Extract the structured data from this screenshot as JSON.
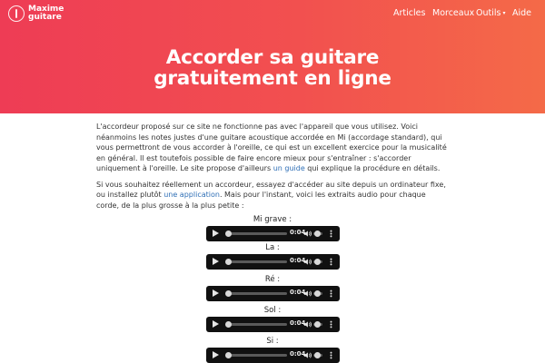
{
  "brand": {
    "line1": "Maxime",
    "line2": "guitare"
  },
  "nav": {
    "articles": "Articles",
    "morceaux": "Morceaux",
    "outils": "Outils",
    "outils_caret": "▾",
    "aide": "Aide"
  },
  "hero": {
    "title": "Accorder sa guitare gratuitement en ligne"
  },
  "content": {
    "p1": "L'accordeur proposé sur ce site ne fonctionne pas avec l'appareil que vous utilisez. Voici néanmoins les notes justes d'une guitare acoustique accordée en Mi (accordage standard), qui vous permettront de vous accorder à l'oreille, ce qui est un excellent exercice pour la musicalité en général. Il est toutefois possible de faire encore mieux pour s'entraîner : s'accorder uniquement à l'oreille. Le site propose d'ailleurs ",
    "p1_link": "un guide",
    "p1_end": " qui explique la procédure en détails.",
    "p2": "Si vous souhaitez réellement un accordeur, essayez d'accéder au site depuis un ordinateur fixe, ou installez plutôt ",
    "p2_link": "une application",
    "p2_end": ". Mais pour l'instant, voici les extraits audio pour chaque corde, de la plus grosse à la plus petite :"
  },
  "tracks": [
    {
      "label": "Mi grave :",
      "time": "0:04"
    },
    {
      "label": "La :",
      "time": "0:04"
    },
    {
      "label": "Ré :",
      "time": "0:04"
    },
    {
      "label": "Sol :",
      "time": "0:04"
    },
    {
      "label": "Si :",
      "time": "0:04"
    }
  ],
  "colors": {
    "gradient_start": "#ee3c55",
    "gradient_end": "#f46a48",
    "link": "#2f6fb6",
    "player_bg": "#111111"
  },
  "icons": [
    "guitar-logo-icon",
    "play-icon",
    "volume-icon",
    "more-options-icon"
  ]
}
